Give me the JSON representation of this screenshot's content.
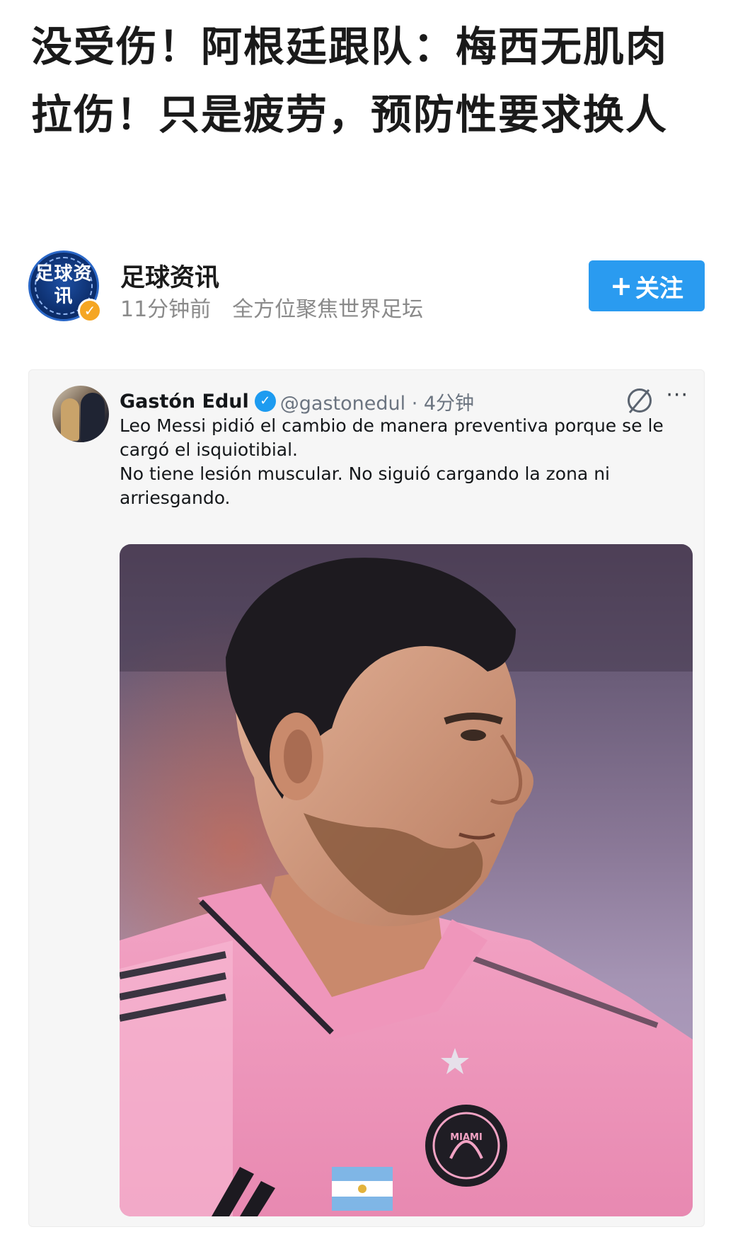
{
  "article": {
    "title": "没受伤！阿根廷跟队：梅西无肌肉拉伤！只是疲劳，预防性要求换人"
  },
  "author": {
    "avatar_text": "足球资讯",
    "name": "足球资讯",
    "time": "11分钟前",
    "tagline": "全方位聚焦世界足坛",
    "follow_label": "关注",
    "follow_icon": "plus-icon",
    "verified_badge_color": "#f5a623"
  },
  "tweet": {
    "name": "Gastón Edul",
    "verified": true,
    "handle_time": "@gastonedul · 4分钟",
    "more_label": "···",
    "lines": [
      "Leo Messi pidió el cambio de manera preventiva porque se le",
      "cargó el isquiotibial.",
      "No tiene lesión muscular. No siguió cargando la zona ni",
      "arriesgando."
    ],
    "photo_icon": "player-photo",
    "accent_color": "#1d9bf0"
  },
  "colors": {
    "follow_button": "#2a9bf0",
    "jersey_pink": "#f2a3c4"
  }
}
